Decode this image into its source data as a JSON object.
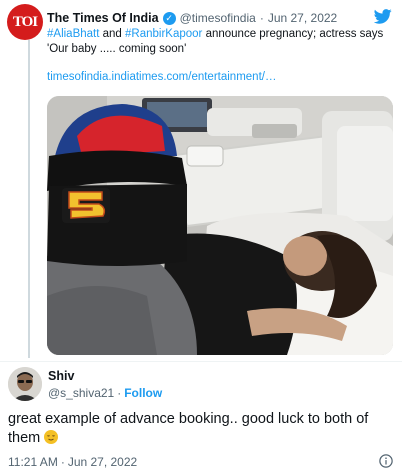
{
  "quoted_tweet": {
    "avatar_text": "TOI",
    "author_name": "The Times Of India",
    "handle": "@timesofindia",
    "separator": "·",
    "date": "Jun 27, 2022",
    "text_hashtag_1": "#AliaBhatt",
    "text_and": " and ",
    "text_hashtag_2": "#RanbirKapoor",
    "text_rest": " announce pregnancy; actress says 'Our baby ..... coming soon'",
    "link_text": "timesofindia.indiatimes.com/entertainment/…"
  },
  "reply_tweet": {
    "author_name": "Shiv",
    "handle": "@s_shiva21",
    "separator": "·",
    "follow_label": "Follow",
    "text": "great example of advance booking.. good luck to both of them",
    "time": "11:21 AM",
    "time_separator": "·",
    "date": "Jun 27, 2022"
  },
  "icons": {
    "twitter": "twitter-bird-icon",
    "verified": "verified-badge-icon",
    "info": "info-icon",
    "emoji": "relieved-face-emoji"
  },
  "colors": {
    "accent": "#1d9bf0",
    "secondary_text": "#536471",
    "toi_red": "#d41c1c"
  }
}
